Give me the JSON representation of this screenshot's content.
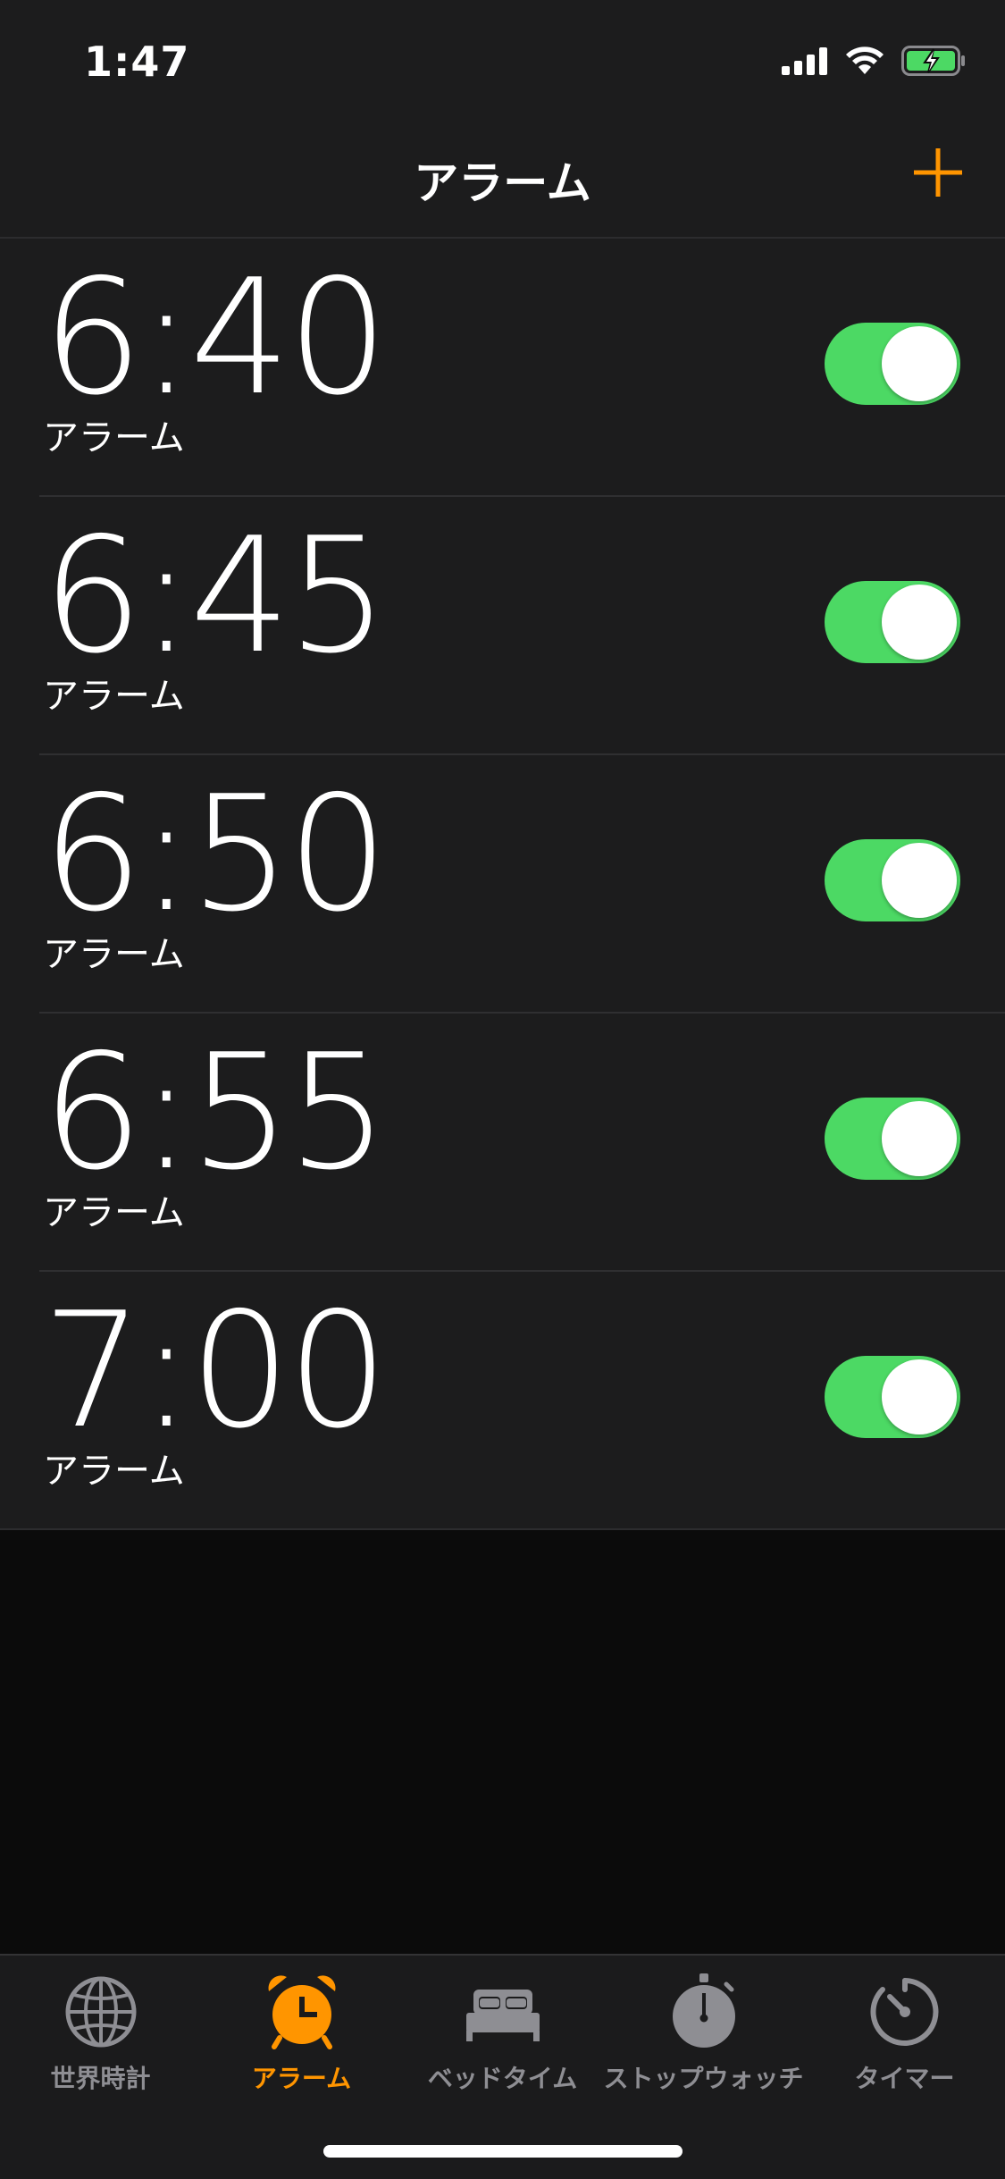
{
  "status_bar": {
    "time": "1:47",
    "signal_icon": "cellular-signal-icon",
    "wifi_icon": "wifi-icon",
    "battery_icon": "battery-charging-icon"
  },
  "nav": {
    "title": "アラーム",
    "add_icon": "plus-icon"
  },
  "alarms": [
    {
      "time": "6:40",
      "label": "アラーム",
      "enabled": true
    },
    {
      "time": "6:45",
      "label": "アラーム",
      "enabled": true
    },
    {
      "time": "6:50",
      "label": "アラーム",
      "enabled": true
    },
    {
      "time": "6:55",
      "label": "アラーム",
      "enabled": true
    },
    {
      "time": "7:00",
      "label": "アラーム",
      "enabled": true
    }
  ],
  "tabs": [
    {
      "label": "世界時計",
      "icon": "globe-icon",
      "active": false
    },
    {
      "label": "アラーム",
      "icon": "alarm-clock-icon",
      "active": true
    },
    {
      "label": "ベッドタイム",
      "icon": "bed-icon",
      "active": false
    },
    {
      "label": "ストップウォッチ",
      "icon": "stopwatch-icon",
      "active": false
    },
    {
      "label": "タイマー",
      "icon": "timer-icon",
      "active": false
    }
  ],
  "colors": {
    "accent": "#ff9500",
    "toggle_on": "#4cd964",
    "tab_inactive": "#8e8e93",
    "background": "#1c1c1d"
  }
}
